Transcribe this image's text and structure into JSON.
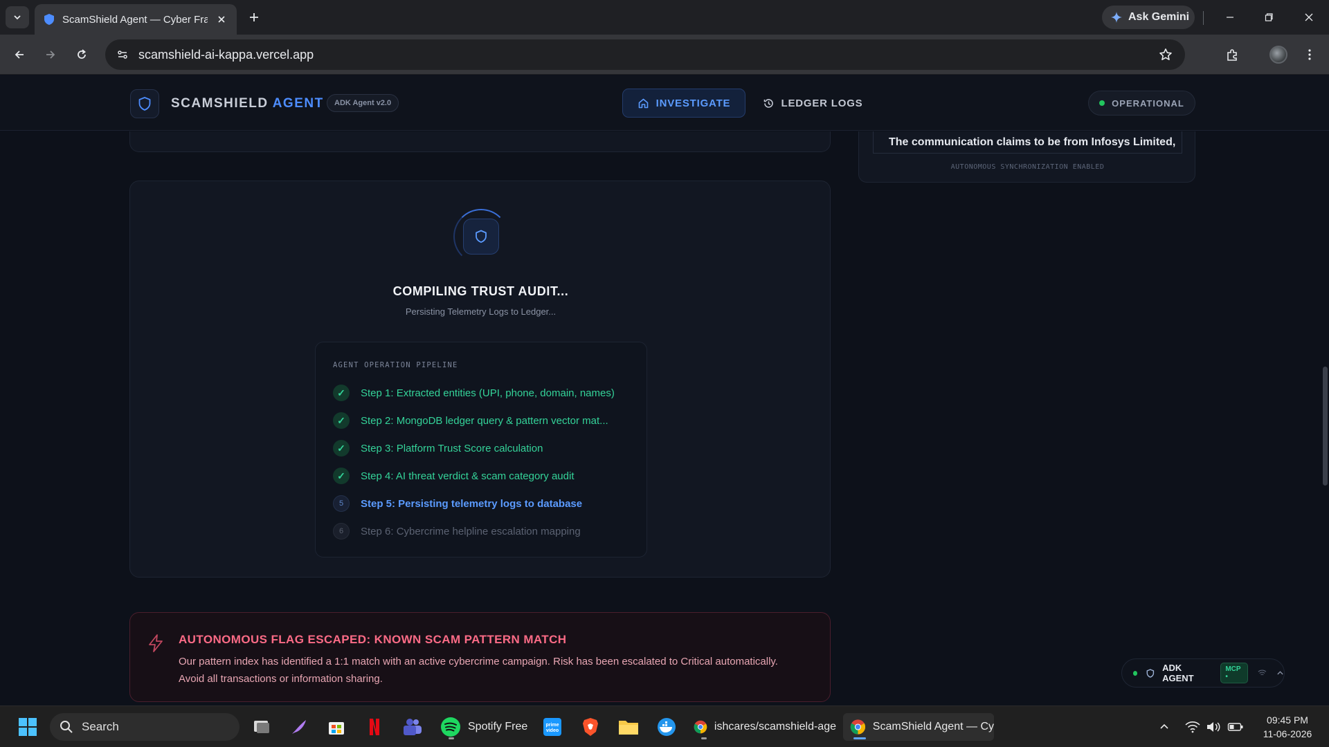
{
  "browser": {
    "tab_title": "ScamShield Agent — Cyber Fra",
    "url": "scamshield-ai-kappa.vercel.app",
    "gemini_label": "Ask Gemini"
  },
  "header": {
    "brand_main": "SCAMSHIELD",
    "brand_accent": "AGENT",
    "version_badge": "ADK Agent v2.0",
    "nav": [
      {
        "label": "INVESTIGATE",
        "active": true
      },
      {
        "label": "LEDGER LOGS",
        "active": false
      }
    ],
    "status": "OPERATIONAL"
  },
  "side_panel": {
    "snippet": "The communication claims to be from Infosys Limited,",
    "sync_note": "AUTONOMOUS SYNCHRONIZATION ENABLED"
  },
  "audit": {
    "title": "COMPILING TRUST AUDIT...",
    "subtitle": "Persisting Telemetry Logs to Ledger...",
    "pipeline_label": "AGENT OPERATION PIPELINE",
    "steps": [
      {
        "number": "1",
        "label": "Step 1: Extracted entities (UPI, phone, domain, names)",
        "state": "done"
      },
      {
        "number": "2",
        "label": "Step 2: MongoDB ledger query & pattern vector mat...",
        "state": "done"
      },
      {
        "number": "3",
        "label": "Step 3: Platform Trust Score calculation",
        "state": "done"
      },
      {
        "number": "4",
        "label": "Step 4: AI threat verdict & scam category audit",
        "state": "done"
      },
      {
        "number": "5",
        "label": "Step 5: Persisting telemetry logs to database",
        "state": "active"
      },
      {
        "number": "6",
        "label": "Step 6: Cybercrime helpline escalation mapping",
        "state": "pending"
      }
    ],
    "check_glyph": "✓"
  },
  "alert": {
    "title": "AUTONOMOUS FLAG ESCAPED: KNOWN SCAM PATTERN MATCH",
    "body": "Our pattern index has identified a 1:1 match with an active cybercrime campaign. Risk has been escalated to Critical automatically. Avoid all transactions or information sharing."
  },
  "adk_widget": {
    "label": "ADK AGENT",
    "badge": "MCP •"
  },
  "taskbar": {
    "search_placeholder": "Search",
    "spotify_label": "Spotify Free",
    "chrome_window_1": "ishcares/scamshield-age",
    "chrome_window_2": "ScamShield Agent — Cy",
    "time": "09:45 PM",
    "date": "11-06-2026"
  },
  "colors": {
    "accent": "#4d8dff",
    "success": "#34d399",
    "danger": "#fb6b86",
    "background": "#0d111a"
  }
}
